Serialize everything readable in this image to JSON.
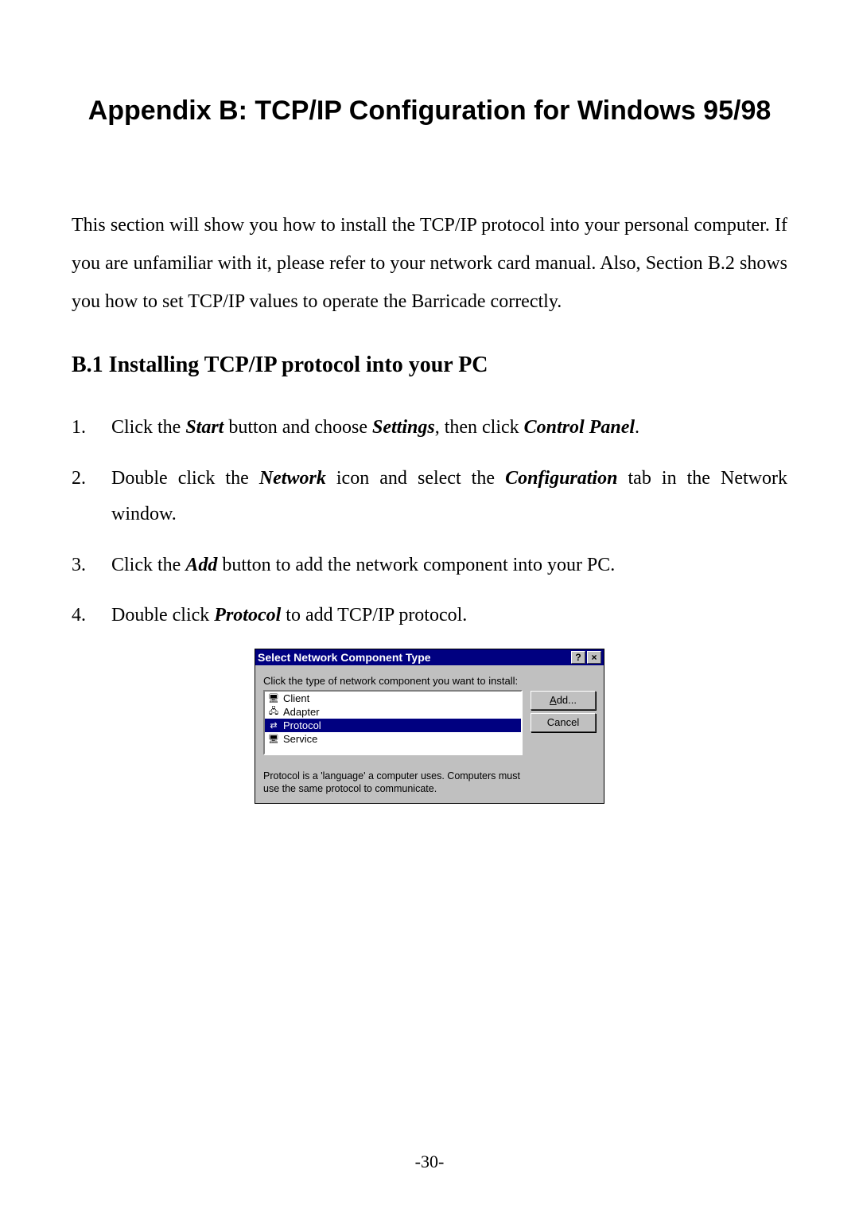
{
  "title": "Appendix B:  TCP/IP Configuration for Windows 95/98",
  "intro": "This section will show you how to install the TCP/IP protocol into your personal computer. If you are unfamiliar with it, please refer to your network card manual. Also, Section B.2 shows you how to set TCP/IP values to operate the Barricade correctly.",
  "subheading": "B.1 Installing TCP/IP protocol into your PC",
  "steps": {
    "s1": {
      "t1": "Click the ",
      "b1": "Start",
      "t2": " button and choose ",
      "b2": "Settings",
      "t3": ", then click ",
      "b3": "Control Panel",
      "t4": "."
    },
    "s2": {
      "t1": "Double click the ",
      "b1": "Network",
      "t2": " icon and select the ",
      "b2": "Configuration",
      "t3": " tab in the Network window."
    },
    "s3": {
      "t1": "Click the ",
      "b1": "Add",
      "t2": " button to add the network component into your PC."
    },
    "s4": {
      "t1": "Double click ",
      "b1": "Protocol",
      "t2": " to add TCP/IP protocol."
    }
  },
  "dialog": {
    "title": "Select Network Component Type",
    "help_btn": "?",
    "close_btn": "×",
    "prompt": "Click the type of network component you want to install:",
    "items": [
      {
        "icon": "🖥",
        "label": "Client"
      },
      {
        "icon": "🖧",
        "label": "Adapter"
      },
      {
        "icon": "⇄",
        "label": "Protocol"
      },
      {
        "icon": "🖥",
        "label": "Service"
      }
    ],
    "selected_index": 2,
    "description": "Protocol is a 'language' a computer uses. Computers must use the same protocol to communicate.",
    "add_btn": "Add...",
    "add_u": "A",
    "cancel_btn": "Cancel"
  },
  "page_number": "-30-"
}
